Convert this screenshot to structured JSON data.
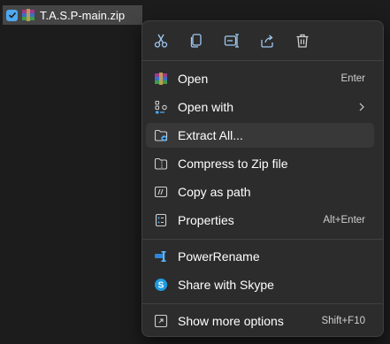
{
  "file": {
    "name": "T.A.S.P-main.zip",
    "selected": true
  },
  "quick_actions": [
    {
      "icon": "cut-icon"
    },
    {
      "icon": "copy-icon"
    },
    {
      "icon": "rename-icon"
    },
    {
      "icon": "share-icon"
    },
    {
      "icon": "delete-icon"
    }
  ],
  "menu": {
    "open": {
      "label": "Open",
      "shortcut": "Enter",
      "icon": "winrar-icon"
    },
    "open_with": {
      "label": "Open with",
      "icon": "open-with-icon"
    },
    "extract_all": {
      "label": "Extract All...",
      "icon": "extract-icon"
    },
    "compress": {
      "label": "Compress to Zip file",
      "icon": "zip-folder-icon"
    },
    "copy_path": {
      "label": "Copy as path",
      "icon": "copy-path-icon"
    },
    "properties": {
      "label": "Properties",
      "shortcut": "Alt+Enter",
      "icon": "properties-icon"
    },
    "power_rename": {
      "label": "PowerRename",
      "icon": "powerrename-icon"
    },
    "skype": {
      "label": "Share with Skype",
      "icon": "skype-icon"
    },
    "more_options": {
      "label": "Show more options",
      "shortcut": "Shift+F10",
      "icon": "more-options-icon"
    }
  },
  "colors": {
    "accent": "#4fa8ee",
    "menu_bg": "#2c2c2c",
    "hover_bg": "#383838"
  }
}
